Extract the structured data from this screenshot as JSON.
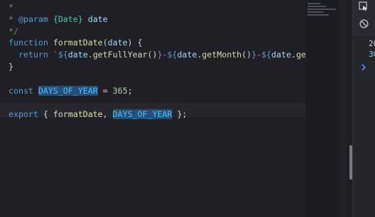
{
  "editor": {
    "lines": [
      {
        "id": "l1",
        "parts": [
          {
            "c": "cm",
            "t": "*"
          }
        ]
      },
      {
        "id": "l2",
        "parts": [
          {
            "c": "cm",
            "t": "* "
          },
          {
            "c": "kw",
            "t": "@param"
          },
          {
            "c": "cm",
            "t": " "
          },
          {
            "c": "ty",
            "t": "{Date}"
          },
          {
            "c": "pm",
            "t": " date"
          }
        ]
      },
      {
        "id": "l3",
        "parts": [
          {
            "c": "cm",
            "t": "*/"
          }
        ]
      },
      {
        "id": "l4",
        "parts": [
          {
            "c": "kw",
            "t": "function"
          },
          {
            "c": "pn",
            "t": " "
          },
          {
            "c": "fn",
            "t": "formatDate"
          },
          {
            "c": "pn",
            "t": "("
          },
          {
            "c": "pm",
            "t": "date"
          },
          {
            "c": "pn",
            "t": ") {"
          }
        ]
      },
      {
        "id": "l5",
        "parts": [
          {
            "c": "pn",
            "t": "  "
          },
          {
            "c": "kw",
            "t": "return"
          },
          {
            "c": "pn",
            "t": " "
          },
          {
            "c": "st",
            "t": "`"
          },
          {
            "c": "tp",
            "t": "${"
          },
          {
            "c": "pm",
            "t": "date"
          },
          {
            "c": "pn",
            "t": "."
          },
          {
            "c": "fn",
            "t": "getFullYear"
          },
          {
            "c": "pn",
            "t": "()"
          },
          {
            "c": "tp",
            "t": "}"
          },
          {
            "c": "st",
            "t": "-"
          },
          {
            "c": "tp",
            "t": "${"
          },
          {
            "c": "pm",
            "t": "date"
          },
          {
            "c": "pn",
            "t": "."
          },
          {
            "c": "fn",
            "t": "getMonth"
          },
          {
            "c": "pn",
            "t": "()"
          },
          {
            "c": "tp",
            "t": "}"
          },
          {
            "c": "st",
            "t": "-"
          },
          {
            "c": "tp",
            "t": "${"
          },
          {
            "c": "pm",
            "t": "date"
          },
          {
            "c": "pn",
            "t": "."
          },
          {
            "c": "fn",
            "t": "getDate"
          }
        ]
      },
      {
        "id": "l6",
        "parts": [
          {
            "c": "pn",
            "t": "}"
          }
        ]
      },
      {
        "id": "l7",
        "parts": []
      },
      {
        "id": "l8",
        "parts": [
          {
            "c": "kw",
            "t": "const"
          },
          {
            "c": "pn",
            "t": " "
          },
          {
            "c": "cs hl",
            "t": "DAYS_OF_YEAR"
          },
          {
            "c": "pn",
            "t": " = "
          },
          {
            "c": "nm",
            "t": "365"
          },
          {
            "c": "pn",
            "t": ";"
          }
        ]
      },
      {
        "id": "l9",
        "parts": []
      },
      {
        "id": "l10",
        "parts": [
          {
            "c": "kw",
            "t": "export"
          },
          {
            "c": "pn",
            "t": " { "
          },
          {
            "c": "fn",
            "t": "formatDate"
          },
          {
            "c": "pn",
            "t": ", "
          },
          {
            "c": "cs hl",
            "t": "DAYS_OF_YEAR"
          },
          {
            "c": "pn",
            "t": " };"
          }
        ]
      }
    ]
  },
  "right_panel": {
    "values": [
      "20",
      "30"
    ]
  }
}
